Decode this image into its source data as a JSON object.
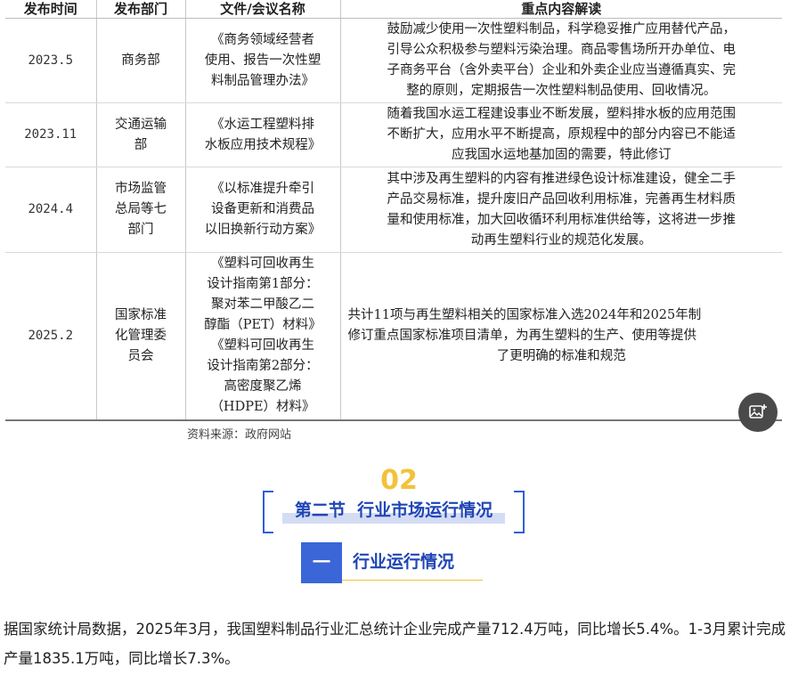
{
  "table": {
    "headers": [
      "发布时间",
      "发布部门",
      "文件/会议名称",
      "重点内容解读"
    ],
    "rows": [
      {
        "date": "2023.5",
        "dept": [
          "商务部"
        ],
        "doc": [
          "《商务领域经营者",
          "使用、报告一次性塑",
          "料制品管理办法》"
        ],
        "desc": [
          "鼓励减少使用一次性塑料制品，科学稳妥推广应用替代产品，",
          "引导公众积极参与塑料污染治理。商品零售场所开办单位、电",
          "子商务平台（含外卖平台）企业和外卖企业应当遵循真实、完",
          "整的原则，定期报告一次性塑料制品使用、回收情况。"
        ]
      },
      {
        "date": "2023.11",
        "dept": [
          "交通运输",
          "部"
        ],
        "doc": [
          "《水运工程塑料排",
          "水板应用技术规程》"
        ],
        "desc": [
          "随着我国水运工程建设事业不断发展，塑料排水板的应用范围",
          "不断扩大，应用水平不断提高，原规程中的部分内容已不能适",
          "应我国水运地基加固的需要，特此修订"
        ]
      },
      {
        "date": "2024.4",
        "dept": [
          "市场监管",
          "总局等七",
          "部门"
        ],
        "doc": [
          "《以标准提升牵引",
          "设备更新和消费品",
          "以旧换新行动方案》"
        ],
        "desc": [
          "其中涉及再生塑料的内容有推进绿色设计标准建设，健全二手",
          "产品交易标准，提升废旧产品回收利用标准，完善再生材料质",
          "量和使用标准，加大回收循环利用标准供给等，这将进一步推",
          "动再生塑料行业的规范化发展。"
        ]
      },
      {
        "date": "2025.2",
        "dept": [
          "国家标准",
          "化管理委",
          "员会"
        ],
        "doc": [
          "《塑料可回收再生",
          "设计指南第1部分：",
          "聚对苯二甲酸乙二",
          "醇酯（PET）材料》",
          "《塑料可回收再生",
          "设计指南第2部分：",
          "高密度聚乙烯",
          "（HDPE）材料》"
        ],
        "desc": [
          "共计11项与再生塑料相关的国家标准入选2024年和2025年制",
          "修订重点国家标准项目清单，为再生塑料的生产、使用等提供",
          "了更明确的标准和规范"
        ]
      }
    ]
  },
  "source": "资料来源：政府网站",
  "image_tool_icon": "image-edit-icon",
  "section": {
    "number": "02",
    "title": "第二节  行业市场运行情况"
  },
  "subsection": {
    "marker": "一",
    "title": "行业运行情况"
  },
  "paragraph": "据国家统计局数据，2025年3月，我国塑料制品行业汇总统计企业完成产量712.4万吨，同比增长5.4%。1-3月累计完成产量1835.1万吨，同比增长7.3%。",
  "colors": {
    "accent_blue": "#2e5fd8",
    "accent_gold": "#f2c23a",
    "title_blue": "#1f45b5"
  }
}
